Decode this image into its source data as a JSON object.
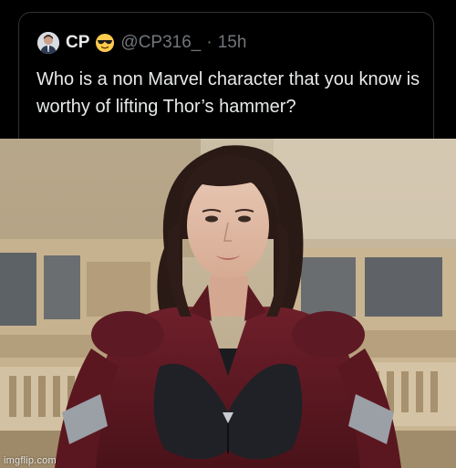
{
  "tweet": {
    "display_name": "CP",
    "handle": "@CP316_",
    "separator": "·",
    "time": "15h",
    "emoji_icon": "sunglasses-face-icon",
    "text": "Who is a non Marvel character that you know is worthy of lifting Thor’s hammer?"
  },
  "photo": {
    "subject": "superhero-woman-photo",
    "watermark": "imgflip.com"
  },
  "colors": {
    "tweet_bg": "#000000",
    "primary_text": "#e7e9ea",
    "secondary_text": "#71767b",
    "suit_red": "#7a1f2b",
    "suit_black": "#1d1f24"
  }
}
